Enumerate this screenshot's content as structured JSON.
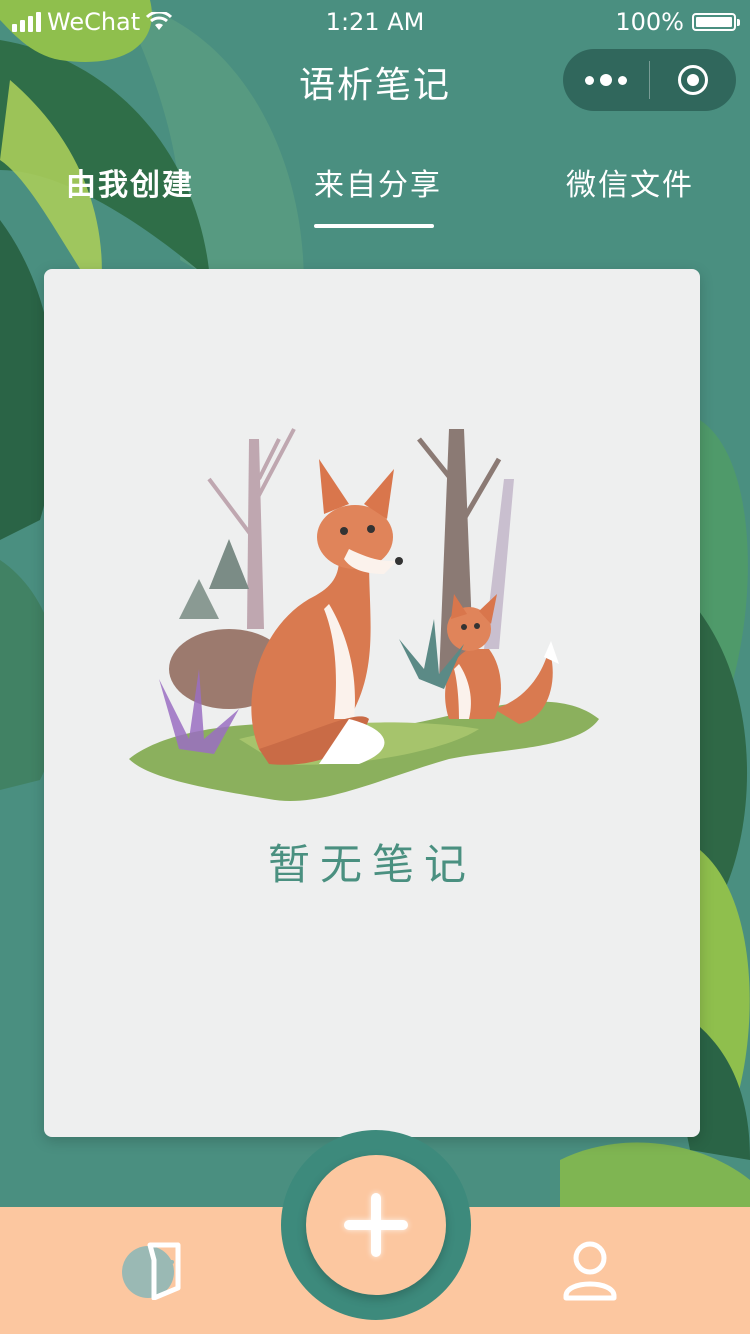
{
  "status_bar": {
    "carrier": "WeChat",
    "time": "1:21 AM",
    "battery": "100%"
  },
  "header": {
    "title": "语析笔记",
    "capsule_icons": [
      "more-dots-icon",
      "close-target-icon"
    ]
  },
  "tabs": [
    {
      "label": "由我创建",
      "active": false
    },
    {
      "label": "来自分享",
      "active": true
    },
    {
      "label": "微信文件",
      "active": false
    }
  ],
  "content": {
    "empty_text": "暂无笔记",
    "illustration": "fox-family-illustration"
  },
  "bottom_nav": {
    "left_icon": "notes-icon",
    "center_icon": "plus-icon",
    "right_icon": "user-icon"
  },
  "colors": {
    "background": "#4a8f80",
    "card": "#eeefef",
    "bottom_bar": "#fcc7a0",
    "accent_text": "#4a9080"
  }
}
